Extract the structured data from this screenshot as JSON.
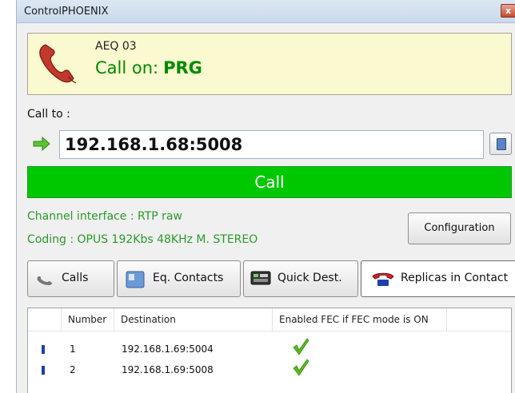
{
  "window": {
    "title": "ControlPHOENIX",
    "close_glyph": "x"
  },
  "call_status": {
    "device": "AEQ 03",
    "status_label": "Call on:",
    "status_value": "PRG",
    "icon": "phone-handset-icon",
    "status_color": "#008a00",
    "panel_bg": "#fbf9cf"
  },
  "call_to": {
    "label": "Call to :",
    "address": "192.168.1.68:5008",
    "arrow_icon": "green-arrow-icon",
    "book_icon": "address-book-icon"
  },
  "call_button": {
    "label": "Call",
    "color": "#00c800"
  },
  "info": {
    "channel": "Channel interface : RTP raw",
    "coding": "Coding : OPUS 192Kbs 48KHz M. STEREO",
    "color": "#2c9a2c"
  },
  "configuration_button": {
    "label": "Configuration"
  },
  "tabs": [
    {
      "label": "Calls",
      "icon": "phone-icon",
      "active": false
    },
    {
      "label": "Eq. Contacts",
      "icon": "contacts-card-icon",
      "active": false
    },
    {
      "label": "Quick Dest.",
      "icon": "quick-dest-icon",
      "active": false
    },
    {
      "label": "Replicas in Contact",
      "icon": "replicas-phone-icon",
      "active": true
    }
  ],
  "table": {
    "columns": [
      "",
      "Number",
      "Destination",
      "Enabled FEC if FEC mode is ON"
    ],
    "rows": [
      {
        "number": "1",
        "destination": "192.168.1.69:5004",
        "fec_enabled": true
      },
      {
        "number": "2",
        "destination": "192.168.1.69:5008",
        "fec_enabled": true
      }
    ],
    "marker_color": "#1e3fb0",
    "check_color": "#59b81f"
  }
}
